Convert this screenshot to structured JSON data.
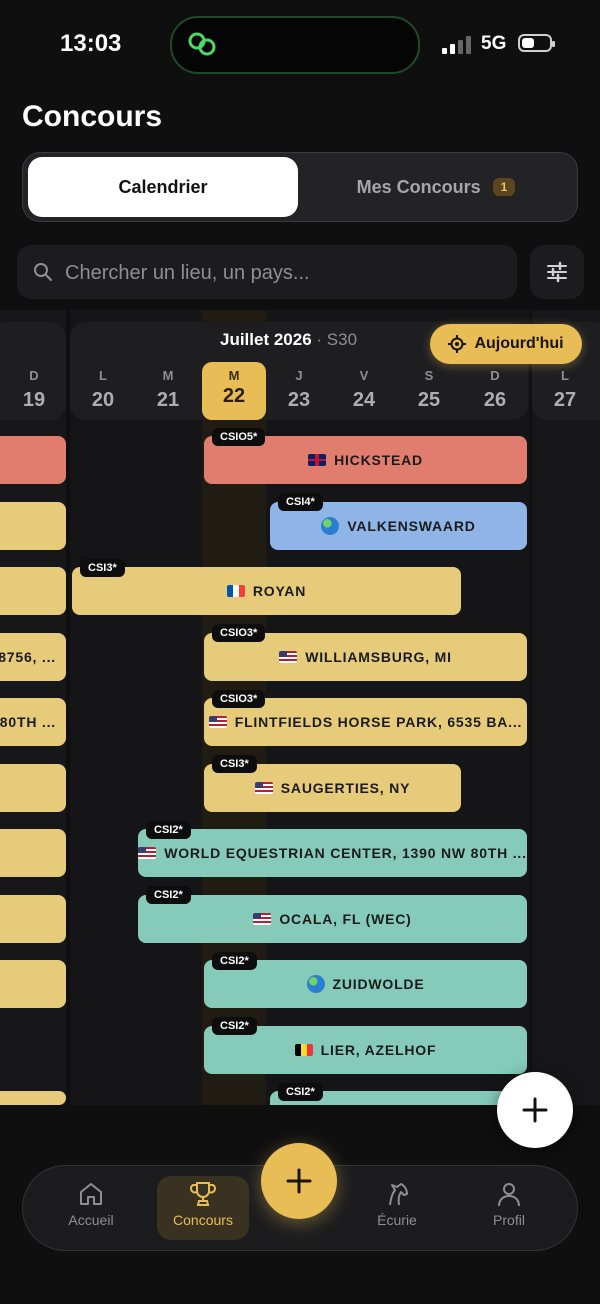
{
  "status": {
    "time": "13:03",
    "network": "5G"
  },
  "page_title": "Concours",
  "segmented": {
    "calendar": "Calendrier",
    "mine": "Mes Concours",
    "mine_count": "1"
  },
  "search": {
    "placeholder": "Chercher un lieu, un pays..."
  },
  "week": {
    "month": "Juillet 2026",
    "week": "· S30",
    "today_button": "Aujourd'hui"
  },
  "days": [
    {
      "letter": "D",
      "num": "19"
    },
    {
      "letter": "L",
      "num": "20"
    },
    {
      "letter": "M",
      "num": "21"
    },
    {
      "letter": "M",
      "num": "22"
    },
    {
      "letter": "J",
      "num": "23"
    },
    {
      "letter": "V",
      "num": "24"
    },
    {
      "letter": "S",
      "num": "25"
    },
    {
      "letter": "D",
      "num": "26"
    },
    {
      "letter": "L",
      "num": "27"
    }
  ],
  "events": [
    {
      "tag": "CSIO5*",
      "name": "HICKSTEAD",
      "flag": "uk"
    },
    {
      "tag": "CSI4*",
      "name": "VALKENSWAARD",
      "flag": "globe"
    },
    {
      "tag": "CSI3*",
      "name": "ROYAN",
      "flag": "fr"
    },
    {
      "tag": "CSIO3*",
      "name": "WILLIAMSBURG, MI",
      "flag": "us"
    },
    {
      "tag": "CSIO3*",
      "name": "FLINTFIELDS HORSE PARK, 6535 BA...",
      "flag": "us"
    },
    {
      "tag": "CSI3*",
      "name": "SAUGERTIES, NY",
      "flag": "us"
    },
    {
      "tag": "CSI2*",
      "name": "WORLD EQUESTRIAN CENTER, 1390 NW 80TH ...",
      "flag": "us"
    },
    {
      "tag": "CSI2*",
      "name": "OCALA, FL (WEC)",
      "flag": "us"
    },
    {
      "tag": "CSI2*",
      "name": "ZUIDWOLDE",
      "flag": "globe"
    },
    {
      "tag": "CSI2*",
      "name": "LIER, AZELHOF",
      "flag": "be"
    },
    {
      "tag": "CSI2*",
      "name": "",
      "flag": ""
    }
  ],
  "prev_week_stubs": [
    "",
    "",
    "",
    "8756, ...",
    "80TH ...",
    "",
    "",
    "",
    "",
    ""
  ],
  "nav": {
    "home": "Accueil",
    "shows": "Concours",
    "stable": "Écurie",
    "profile": "Profil"
  },
  "colors": {
    "gold": "#e9bd55",
    "yellow": "#e6cb7b",
    "red": "#e07d6e",
    "blue": "#8fb5e8",
    "teal": "#86cbb9"
  }
}
